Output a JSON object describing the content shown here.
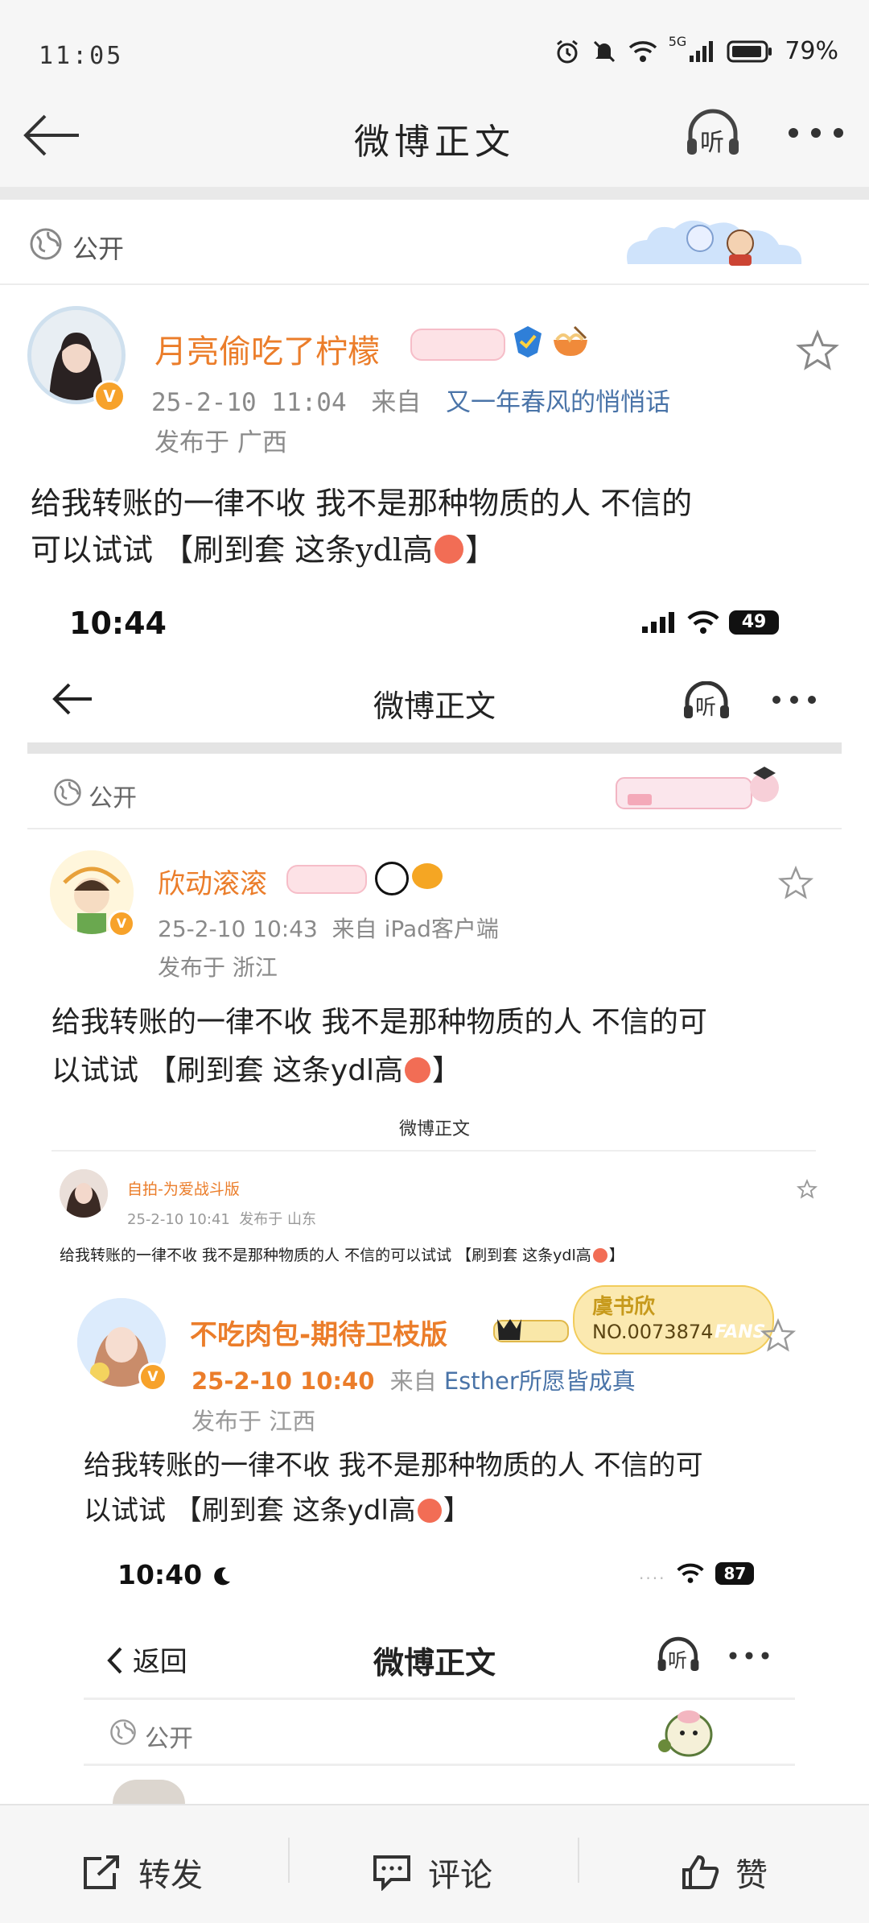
{
  "status_bar": {
    "time": "11:05",
    "network": "5G",
    "battery": "79%"
  },
  "header": {
    "title": "微博正文"
  },
  "visibility": {
    "label": "公开"
  },
  "post": {
    "author": "月亮偷吃了柠檬",
    "date": "25-2-10 11:04",
    "from_label": "来自",
    "source": "又一年春风的悄悄话",
    "location": "发布于 广西",
    "text_line1": "给我转账的一律不收 我不是那种物质的人 不信的",
    "text_line2": "可以试试 【刷到套 这条ydl高",
    "text_end": "】"
  },
  "nested1": {
    "status_time": "10:44",
    "battery": "49",
    "title": "微博正文",
    "visibility": "公开",
    "author": "欣动滚滚",
    "meta": "25-2-10 10:43  来自 iPad客户端",
    "location": "发布于 浙江",
    "text_line1": "给我转账的一律不收 我不是那种物质的人 不信的可",
    "text_line2": "以试试 【刷到套 这条ydl高",
    "text_end": "】"
  },
  "nested2": {
    "title": "微博正文",
    "author": "自拍-为爱战斗版",
    "meta": "25-2-10 10:41  发布于 山东",
    "text": "给我转账的一律不收 我不是那种物质的人 不信的可以试试 【刷到套 这条ydl高",
    "text_end": "】"
  },
  "nested3": {
    "author": "不吃肉包-期待卫枝版",
    "fan_badge_title": "虞书欣",
    "fan_badge_no": "NO.0073874",
    "fan_badge_tag": "FANS",
    "date": "25-2-10 10:40",
    "from_label": "来自",
    "source": "Esther所愿皆成真",
    "location": "发布于 江西",
    "text_line1": "给我转账的一律不收 我不是那种物质的人 不信的可",
    "text_line2": "以试试 【刷到套 这条ydl高",
    "text_end": "】"
  },
  "nested4": {
    "status_time": "10:40",
    "battery": "87",
    "back_label": "返回",
    "title": "微博正文",
    "visibility": "公开"
  },
  "listen_label": "听",
  "bottom_bar": {
    "repost": "转发",
    "comment": "评论",
    "like": "赞"
  }
}
